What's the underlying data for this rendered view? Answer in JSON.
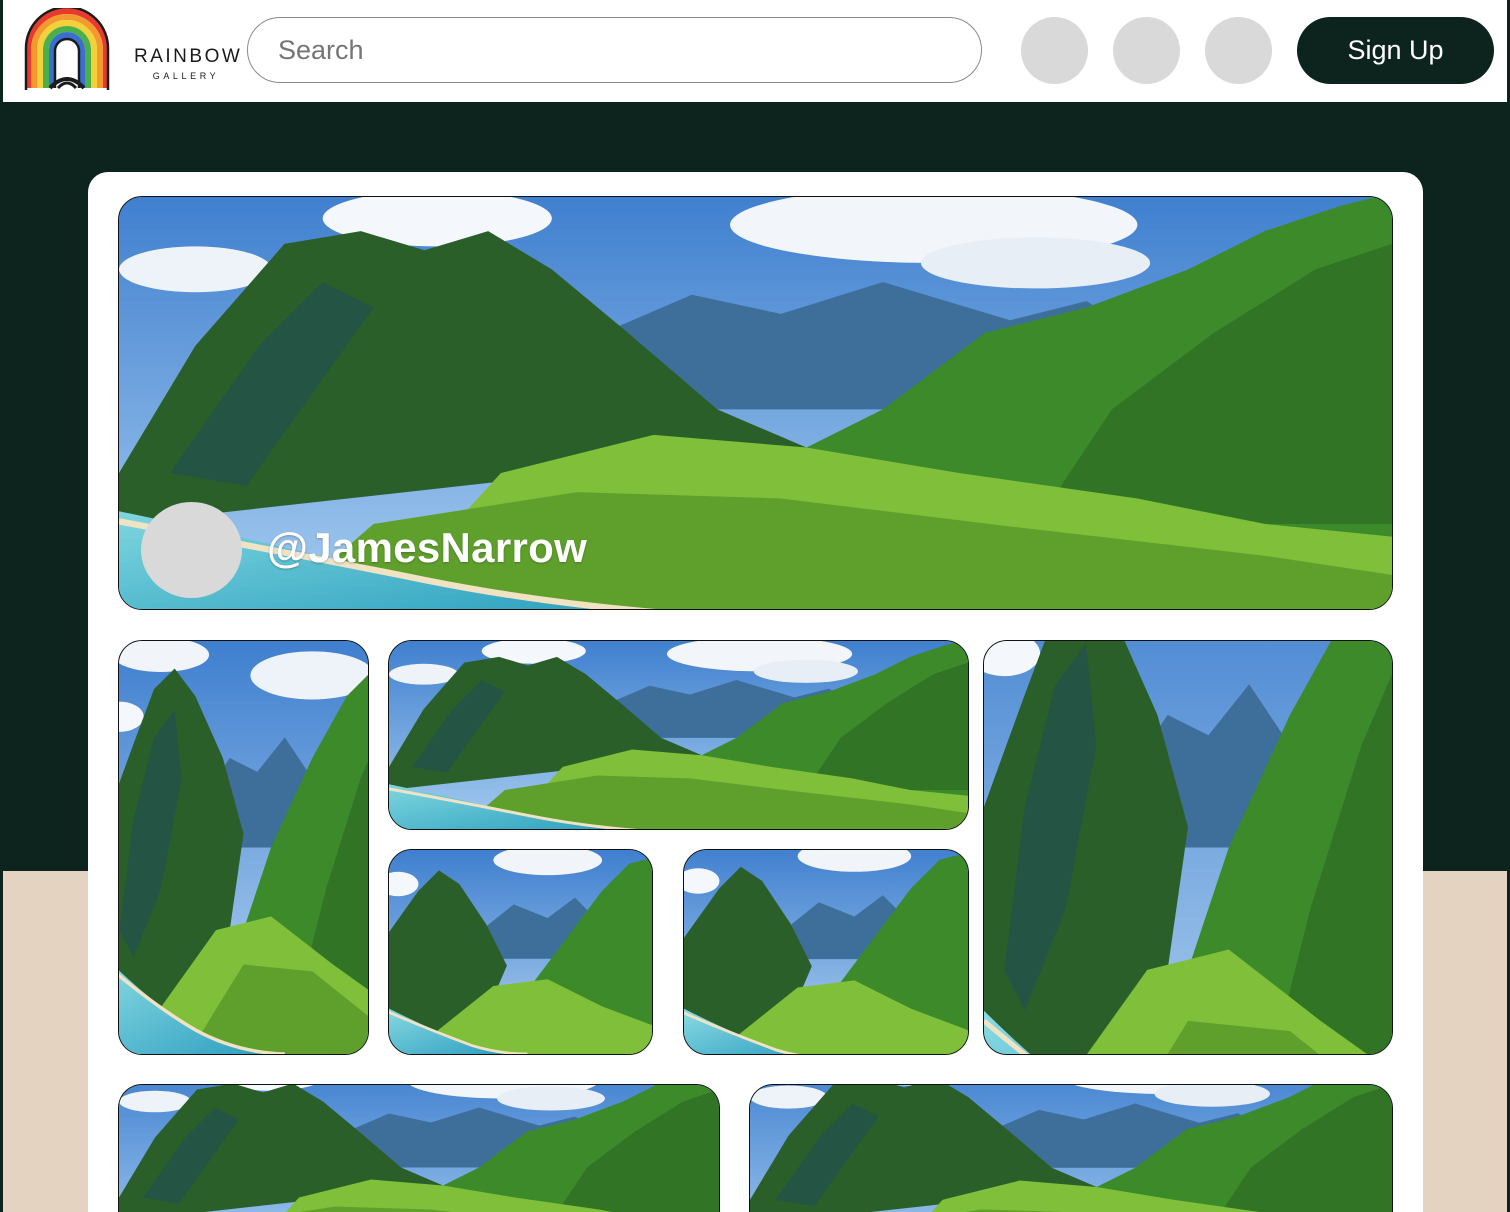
{
  "brand": {
    "name": "RAINBOW",
    "tagline": "GALLERY"
  },
  "search": {
    "placeholder": "Search",
    "icon": "search"
  },
  "header": {
    "action_buttons": [
      "blank-circle-button",
      "blank-circle-button",
      "blank-circle-button"
    ],
    "signup_label": "Sign Up"
  },
  "profile": {
    "username": "@JamesNarrow",
    "avatar": "blank-avatar"
  },
  "gallery": {
    "banner_image": "mountain-valley-coastline-landscape",
    "photos": [
      "mountain-valley-photo-portrait",
      "mountain-valley-photo-wide",
      "mountain-valley-photo-small",
      "mountain-valley-photo-small",
      "mountain-valley-photo-portrait",
      "mountain-valley-photo-wide",
      "mountain-valley-photo-wide"
    ]
  },
  "colors": {
    "brand_dark": "#0c241d",
    "beige": "#e3d3c0",
    "placeholder_grey": "#d9d9d9",
    "sky": "#4a86c8",
    "mountain": "#2f7a2a",
    "sea": "#4cc0cf"
  }
}
